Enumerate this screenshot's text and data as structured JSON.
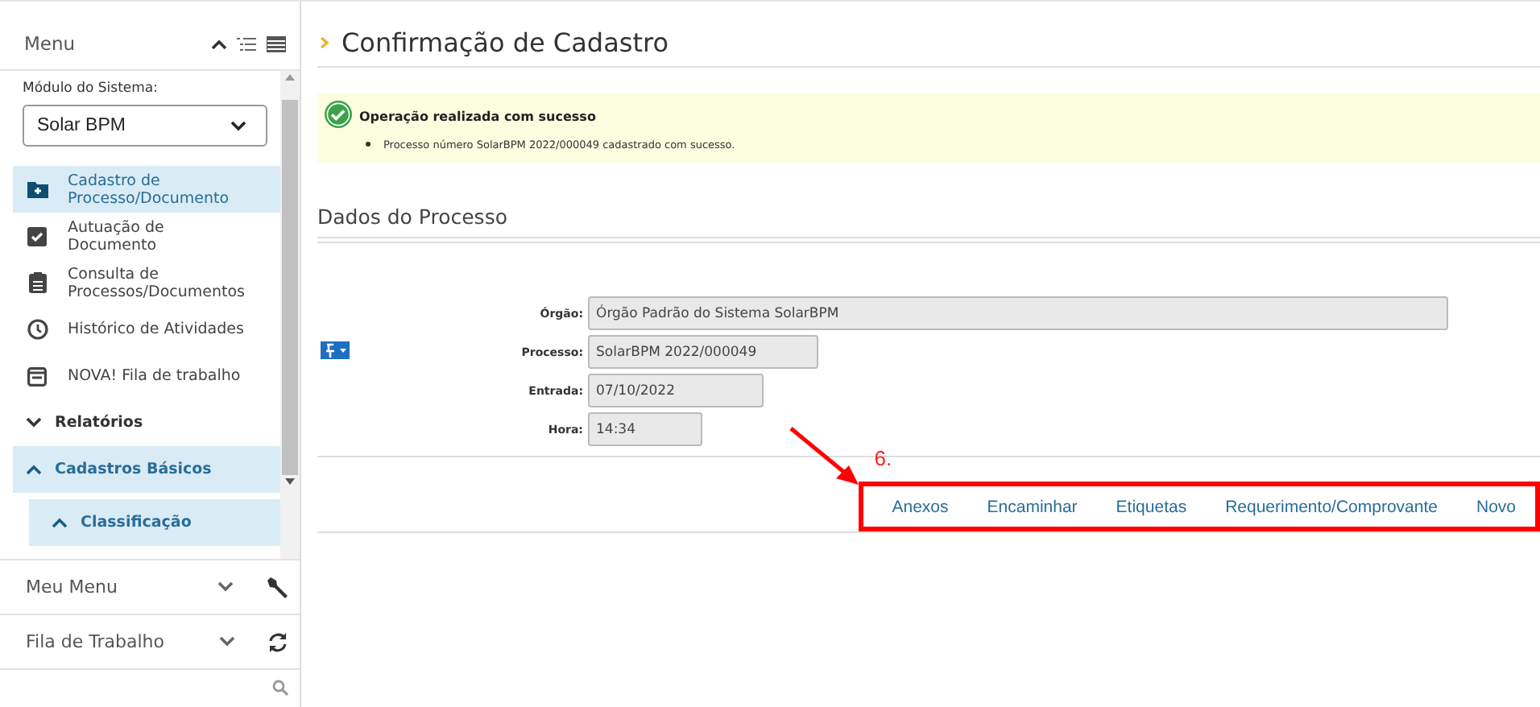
{
  "sidebar": {
    "title": "Menu",
    "module_label": "Módulo do Sistema:",
    "module_value": "Solar BPM",
    "items": [
      {
        "kind": "item",
        "label": "Cadastro de Processo/Documento",
        "selected": true
      },
      {
        "kind": "item",
        "label": "Autuação de Documento",
        "selected": false
      },
      {
        "kind": "item",
        "label": "Consulta de Processos/Documentos",
        "selected": false
      },
      {
        "kind": "item",
        "label": "Histórico de Atividades",
        "selected": false
      },
      {
        "kind": "item",
        "label": "NOVA! Fila de trabalho",
        "selected": false
      },
      {
        "kind": "group",
        "label": "Relatórios",
        "selected": false,
        "expanded": false
      },
      {
        "kind": "group",
        "label": "Cadastros Básicos",
        "selected": true,
        "expanded": true
      },
      {
        "kind": "subgroup",
        "label": "Classificação",
        "selected": true,
        "expanded": true
      }
    ],
    "panels": [
      {
        "label": "Meu Menu",
        "expanded": false
      },
      {
        "label": "Fila de Trabalho",
        "expanded": false
      }
    ]
  },
  "page": {
    "title": "Confirmação de Cadastro",
    "alert": {
      "title": "Operação realizada com sucesso",
      "message": "Processo número SolarBPM 2022/000049 cadastrado com sucesso."
    },
    "section": "Dados do Processo",
    "fields": [
      {
        "label": "Órgão:",
        "value": "Órgão Padrão do Sistema SolarBPM"
      },
      {
        "label": "Processo:",
        "value": "SolarBPM 2022/000049"
      },
      {
        "label": "Entrada:",
        "value": "07/10/2022"
      },
      {
        "label": "Hora:",
        "value": "14:34"
      }
    ],
    "actions": [
      "Anexos",
      "Encaminhar",
      "Etiquetas",
      "Requerimento/Comprovante",
      "Novo"
    ],
    "annotation": "6."
  }
}
